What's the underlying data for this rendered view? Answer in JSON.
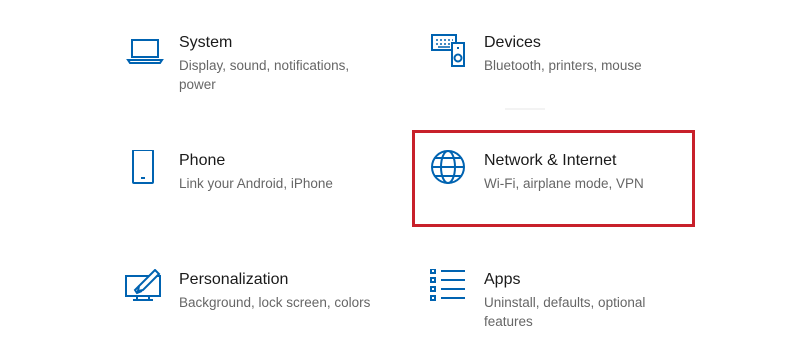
{
  "tiles": {
    "system": {
      "title": "System",
      "desc": "Display, sound, notifications, power",
      "icon": "laptop-icon"
    },
    "devices": {
      "title": "Devices",
      "desc": "Bluetooth, printers, mouse",
      "icon": "devices-icon"
    },
    "phone": {
      "title": "Phone",
      "desc": "Link your Android, iPhone",
      "icon": "phone-icon"
    },
    "network": {
      "title": "Network & Internet",
      "desc": "Wi-Fi, airplane mode, VPN",
      "icon": "globe-icon"
    },
    "personalization": {
      "title": "Personalization",
      "desc": "Background, lock screen, colors",
      "icon": "personalization-icon"
    },
    "apps": {
      "title": "Apps",
      "desc": "Uninstall, defaults, optional features",
      "icon": "apps-list-icon"
    }
  },
  "colors": {
    "icon": "#0063b1",
    "highlight": "#c8202a"
  }
}
